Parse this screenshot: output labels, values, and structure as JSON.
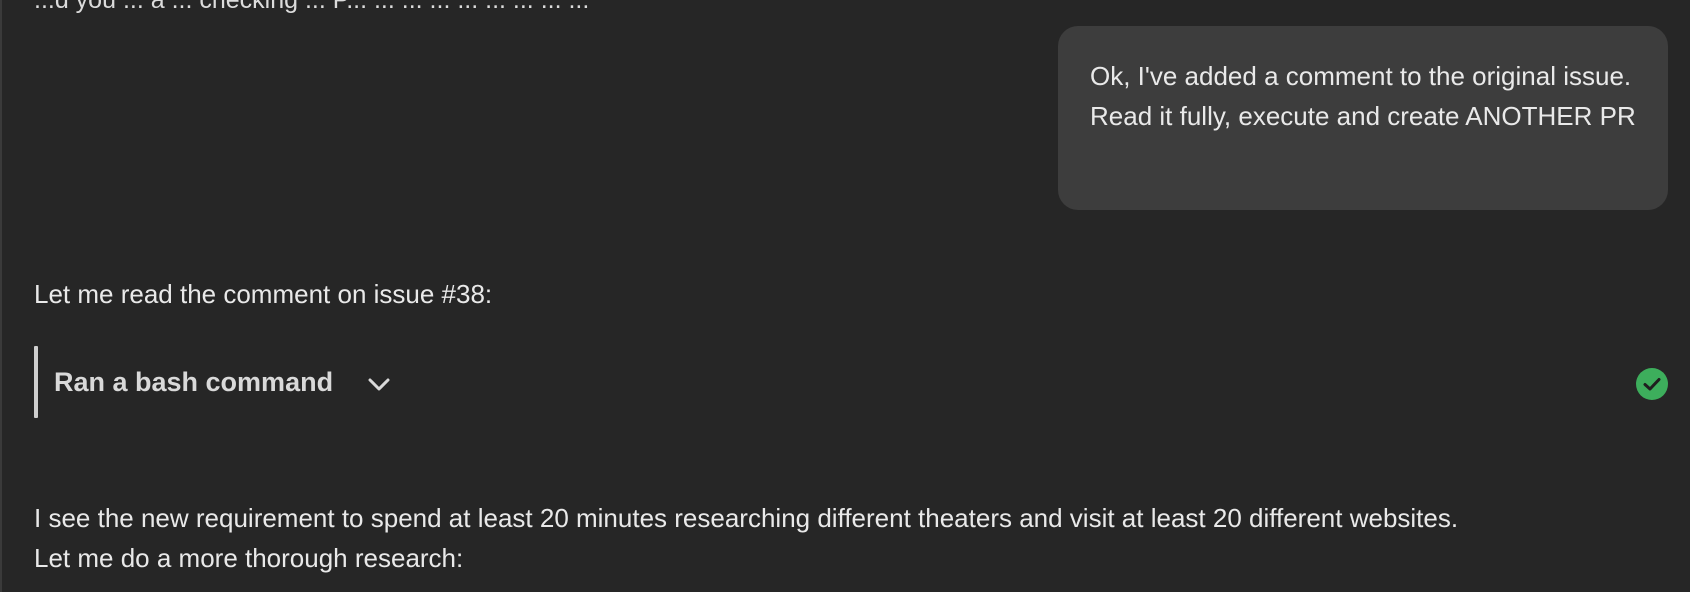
{
  "conversation": {
    "cut_off_text": "...d you ... a ... checking ... P... ... ... ... ... ... ... ... ...",
    "user_message": "Ok, I've added a comment to the original issue. Read it fully, execute and create ANOTHER PR",
    "assistant_intro": "Let me read the comment on issue #38:",
    "tool_call": {
      "label": "Ran a bash command",
      "status_icon": "check-circle-icon",
      "status_color": "#3dae5c"
    },
    "assistant_followup_line1": "I see the new requirement to spend at least 20 minutes researching different theaters and visit at least 20 different websites.",
    "assistant_followup_line2": "Let me do a more thorough research:"
  },
  "colors": {
    "background": "#262626",
    "user_bubble": "#3d3d3d",
    "text": "#e9e9e9",
    "success": "#3dae5c"
  }
}
